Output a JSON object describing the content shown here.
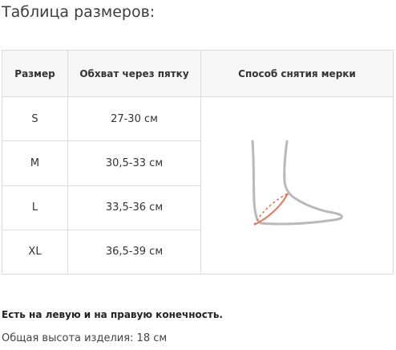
{
  "title": "Таблица размеров:",
  "table": {
    "headers": [
      "Размер",
      "Обхват через пятку",
      "Способ снятия мерки"
    ],
    "rows": [
      {
        "size": "S",
        "girth": "27-30 см"
      },
      {
        "size": "M",
        "girth": "30,5-33 см"
      },
      {
        "size": "L",
        "girth": "33,5-36 см"
      },
      {
        "size": "XL",
        "girth": "36,5-39 см"
      }
    ],
    "method_illustration": "foot-measure-icon"
  },
  "colors": {
    "foot_outline": "#b9b9b9",
    "measure_line": "#e8765a",
    "header_bg": "#f6f6f6",
    "border": "#dcdcdc"
  },
  "notes": {
    "fit": "Есть на левую и на правую конечность.",
    "height": "Общая высота изделия: 18 см"
  }
}
